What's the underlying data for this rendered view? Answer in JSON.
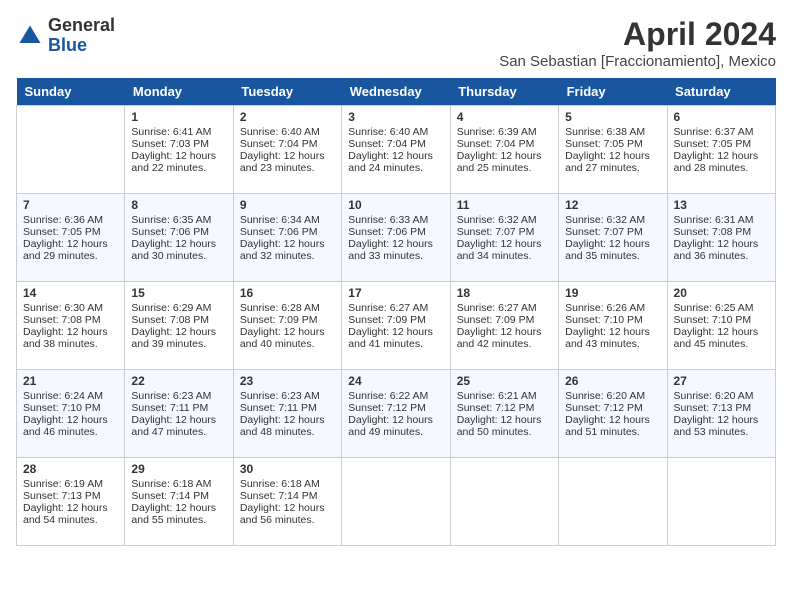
{
  "logo": {
    "general": "General",
    "blue": "Blue"
  },
  "header": {
    "month": "April 2024",
    "location": "San Sebastian [Fraccionamiento], Mexico"
  },
  "days_of_week": [
    "Sunday",
    "Monday",
    "Tuesday",
    "Wednesday",
    "Thursday",
    "Friday",
    "Saturday"
  ],
  "weeks": [
    [
      {
        "day": null
      },
      {
        "day": 1,
        "sunrise": "Sunrise: 6:41 AM",
        "sunset": "Sunset: 7:03 PM",
        "daylight": "Daylight: 12 hours and 22 minutes."
      },
      {
        "day": 2,
        "sunrise": "Sunrise: 6:40 AM",
        "sunset": "Sunset: 7:04 PM",
        "daylight": "Daylight: 12 hours and 23 minutes."
      },
      {
        "day": 3,
        "sunrise": "Sunrise: 6:40 AM",
        "sunset": "Sunset: 7:04 PM",
        "daylight": "Daylight: 12 hours and 24 minutes."
      },
      {
        "day": 4,
        "sunrise": "Sunrise: 6:39 AM",
        "sunset": "Sunset: 7:04 PM",
        "daylight": "Daylight: 12 hours and 25 minutes."
      },
      {
        "day": 5,
        "sunrise": "Sunrise: 6:38 AM",
        "sunset": "Sunset: 7:05 PM",
        "daylight": "Daylight: 12 hours and 27 minutes."
      },
      {
        "day": 6,
        "sunrise": "Sunrise: 6:37 AM",
        "sunset": "Sunset: 7:05 PM",
        "daylight": "Daylight: 12 hours and 28 minutes."
      }
    ],
    [
      {
        "day": 7,
        "sunrise": "Sunrise: 6:36 AM",
        "sunset": "Sunset: 7:05 PM",
        "daylight": "Daylight: 12 hours and 29 minutes."
      },
      {
        "day": 8,
        "sunrise": "Sunrise: 6:35 AM",
        "sunset": "Sunset: 7:06 PM",
        "daylight": "Daylight: 12 hours and 30 minutes."
      },
      {
        "day": 9,
        "sunrise": "Sunrise: 6:34 AM",
        "sunset": "Sunset: 7:06 PM",
        "daylight": "Daylight: 12 hours and 32 minutes."
      },
      {
        "day": 10,
        "sunrise": "Sunrise: 6:33 AM",
        "sunset": "Sunset: 7:06 PM",
        "daylight": "Daylight: 12 hours and 33 minutes."
      },
      {
        "day": 11,
        "sunrise": "Sunrise: 6:32 AM",
        "sunset": "Sunset: 7:07 PM",
        "daylight": "Daylight: 12 hours and 34 minutes."
      },
      {
        "day": 12,
        "sunrise": "Sunrise: 6:32 AM",
        "sunset": "Sunset: 7:07 PM",
        "daylight": "Daylight: 12 hours and 35 minutes."
      },
      {
        "day": 13,
        "sunrise": "Sunrise: 6:31 AM",
        "sunset": "Sunset: 7:08 PM",
        "daylight": "Daylight: 12 hours and 36 minutes."
      }
    ],
    [
      {
        "day": 14,
        "sunrise": "Sunrise: 6:30 AM",
        "sunset": "Sunset: 7:08 PM",
        "daylight": "Daylight: 12 hours and 38 minutes."
      },
      {
        "day": 15,
        "sunrise": "Sunrise: 6:29 AM",
        "sunset": "Sunset: 7:08 PM",
        "daylight": "Daylight: 12 hours and 39 minutes."
      },
      {
        "day": 16,
        "sunrise": "Sunrise: 6:28 AM",
        "sunset": "Sunset: 7:09 PM",
        "daylight": "Daylight: 12 hours and 40 minutes."
      },
      {
        "day": 17,
        "sunrise": "Sunrise: 6:27 AM",
        "sunset": "Sunset: 7:09 PM",
        "daylight": "Daylight: 12 hours and 41 minutes."
      },
      {
        "day": 18,
        "sunrise": "Sunrise: 6:27 AM",
        "sunset": "Sunset: 7:09 PM",
        "daylight": "Daylight: 12 hours and 42 minutes."
      },
      {
        "day": 19,
        "sunrise": "Sunrise: 6:26 AM",
        "sunset": "Sunset: 7:10 PM",
        "daylight": "Daylight: 12 hours and 43 minutes."
      },
      {
        "day": 20,
        "sunrise": "Sunrise: 6:25 AM",
        "sunset": "Sunset: 7:10 PM",
        "daylight": "Daylight: 12 hours and 45 minutes."
      }
    ],
    [
      {
        "day": 21,
        "sunrise": "Sunrise: 6:24 AM",
        "sunset": "Sunset: 7:10 PM",
        "daylight": "Daylight: 12 hours and 46 minutes."
      },
      {
        "day": 22,
        "sunrise": "Sunrise: 6:23 AM",
        "sunset": "Sunset: 7:11 PM",
        "daylight": "Daylight: 12 hours and 47 minutes."
      },
      {
        "day": 23,
        "sunrise": "Sunrise: 6:23 AM",
        "sunset": "Sunset: 7:11 PM",
        "daylight": "Daylight: 12 hours and 48 minutes."
      },
      {
        "day": 24,
        "sunrise": "Sunrise: 6:22 AM",
        "sunset": "Sunset: 7:12 PM",
        "daylight": "Daylight: 12 hours and 49 minutes."
      },
      {
        "day": 25,
        "sunrise": "Sunrise: 6:21 AM",
        "sunset": "Sunset: 7:12 PM",
        "daylight": "Daylight: 12 hours and 50 minutes."
      },
      {
        "day": 26,
        "sunrise": "Sunrise: 6:20 AM",
        "sunset": "Sunset: 7:12 PM",
        "daylight": "Daylight: 12 hours and 51 minutes."
      },
      {
        "day": 27,
        "sunrise": "Sunrise: 6:20 AM",
        "sunset": "Sunset: 7:13 PM",
        "daylight": "Daylight: 12 hours and 53 minutes."
      }
    ],
    [
      {
        "day": 28,
        "sunrise": "Sunrise: 6:19 AM",
        "sunset": "Sunset: 7:13 PM",
        "daylight": "Daylight: 12 hours and 54 minutes."
      },
      {
        "day": 29,
        "sunrise": "Sunrise: 6:18 AM",
        "sunset": "Sunset: 7:14 PM",
        "daylight": "Daylight: 12 hours and 55 minutes."
      },
      {
        "day": 30,
        "sunrise": "Sunrise: 6:18 AM",
        "sunset": "Sunset: 7:14 PM",
        "daylight": "Daylight: 12 hours and 56 minutes."
      },
      {
        "day": null
      },
      {
        "day": null
      },
      {
        "day": null
      },
      {
        "day": null
      }
    ]
  ]
}
